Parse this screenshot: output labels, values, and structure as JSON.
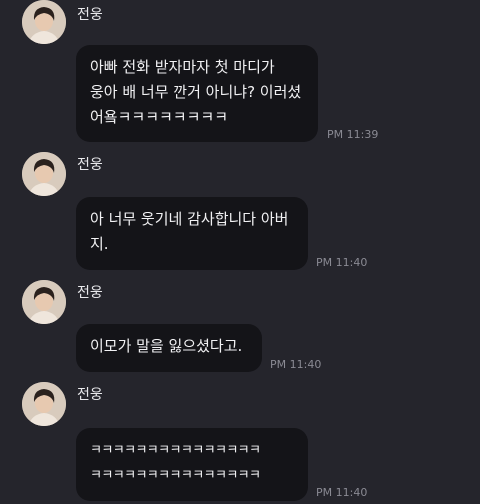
{
  "messages": [
    {
      "sender": "전웅",
      "text": "아빠 전화 받자마자 첫 마디가\n웅아 배 너무 깐거 아니냐? 이러셨\n어욬ㅋㅋㅋㅋㅋㅋㅋㅋ",
      "time": "PM 11:39"
    },
    {
      "sender": "전웅",
      "text": "아 너무 웃기네 감사합니다 아버\n지.",
      "time": "PM 11:40"
    },
    {
      "sender": "전웅",
      "text": "이모가 말을 잃으셨다고.",
      "time": "PM 11:40"
    },
    {
      "sender": "전웅",
      "text": "ㅋㅋㅋㅋㅋㅋㅋㅋㅋㅋㅋㅋㅋㅋㅋ\nㅋㅋㅋㅋㅋㅋㅋㅋㅋㅋㅋㅋㅋㅋㅋ",
      "time": "PM 11:40"
    }
  ]
}
